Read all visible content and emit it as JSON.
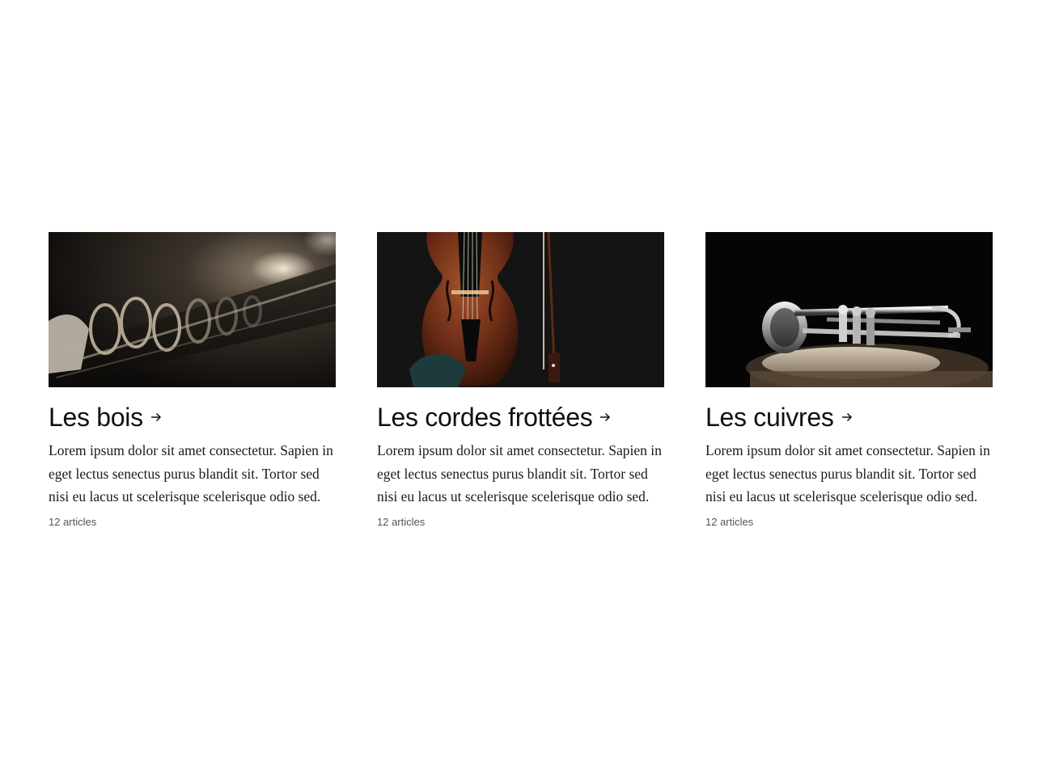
{
  "cards": [
    {
      "image": "clarinet-keys-photo",
      "title": "Les bois",
      "description": "Lorem ipsum dolor sit amet consectetur. Sapien in eget lectus senectus purus blandit sit. Tortor sed nisi eu lacus ut scelerisque scelerisque odio sed.",
      "count": "12 articles"
    },
    {
      "image": "violin-and-bow-photo",
      "title": "Les cordes frottées",
      "description": "Lorem ipsum dolor sit amet consectetur. Sapien in eget lectus senectus purus blandit sit. Tortor sed nisi eu lacus ut scelerisque scelerisque odio sed.",
      "count": "12 articles"
    },
    {
      "image": "trumpet-on-drum-photo",
      "title": "Les cuivres",
      "description": "Lorem ipsum dolor sit amet consectetur. Sapien in eget lectus senectus purus blandit sit. Tortor sed nisi eu lacus ut scelerisque scelerisque odio sed.",
      "count": "12 articles"
    }
  ],
  "icons": {
    "arrow": "arrow-right-icon"
  },
  "colors": {
    "background": "#ffffff",
    "text": "#111111",
    "meta": "#555555"
  }
}
